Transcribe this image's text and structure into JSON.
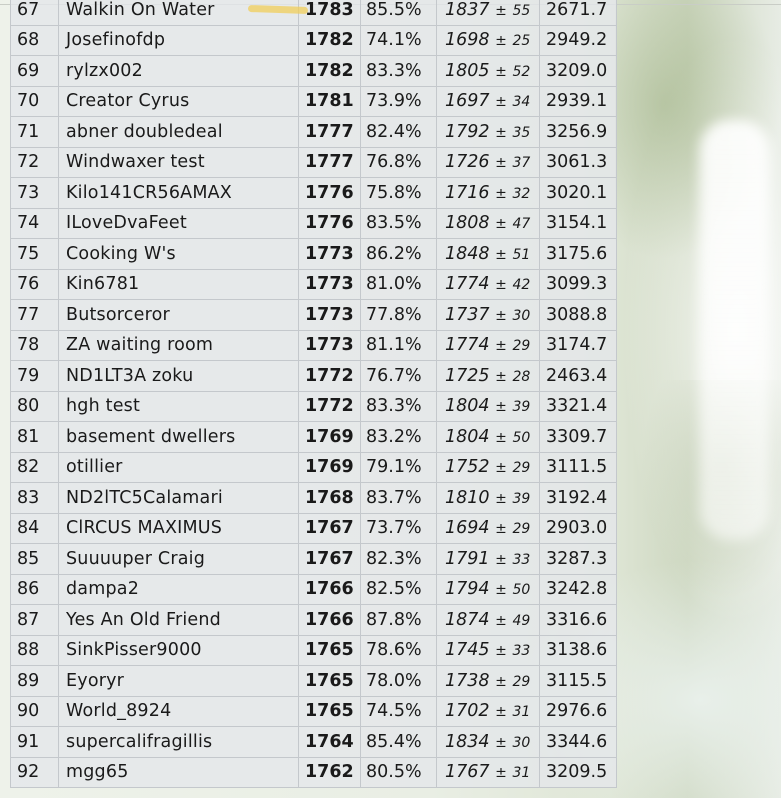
{
  "rows": [
    {
      "rank": "67",
      "name": "Walkin On Water",
      "rating": "1783",
      "win": "85.5%",
      "est": "1837",
      "err": "55",
      "score": "2671.7"
    },
    {
      "rank": "68",
      "name": "Josefinofdp",
      "rating": "1782",
      "win": "74.1%",
      "est": "1698",
      "err": "25",
      "score": "2949.2"
    },
    {
      "rank": "69",
      "name": "rylzx002",
      "rating": "1782",
      "win": "83.3%",
      "est": "1805",
      "err": "52",
      "score": "3209.0"
    },
    {
      "rank": "70",
      "name": "Creator Cyrus",
      "rating": "1781",
      "win": "73.9%",
      "est": "1697",
      "err": "34",
      "score": "2939.1"
    },
    {
      "rank": "71",
      "name": "abner doubledeal",
      "rating": "1777",
      "win": "82.4%",
      "est": "1792",
      "err": "35",
      "score": "3256.9"
    },
    {
      "rank": "72",
      "name": "Windwaxer test",
      "rating": "1777",
      "win": "76.8%",
      "est": "1726",
      "err": "37",
      "score": "3061.3"
    },
    {
      "rank": "73",
      "name": "Kilo141CR56AMAX",
      "rating": "1776",
      "win": "75.8%",
      "est": "1716",
      "err": "32",
      "score": "3020.1"
    },
    {
      "rank": "74",
      "name": "ILoveDvaFeet",
      "rating": "1776",
      "win": "83.5%",
      "est": "1808",
      "err": "47",
      "score": "3154.1"
    },
    {
      "rank": "75",
      "name": "Cooking W's",
      "rating": "1773",
      "win": "86.2%",
      "est": "1848",
      "err": "51",
      "score": "3175.6"
    },
    {
      "rank": "76",
      "name": "Kin6781",
      "rating": "1773",
      "win": "81.0%",
      "est": "1774",
      "err": "42",
      "score": "3099.3"
    },
    {
      "rank": "77",
      "name": "Butsorceror",
      "rating": "1773",
      "win": "77.8%",
      "est": "1737",
      "err": "30",
      "score": "3088.8"
    },
    {
      "rank": "78",
      "name": "ZA waiting room",
      "rating": "1773",
      "win": "81.1%",
      "est": "1774",
      "err": "29",
      "score": "3174.7"
    },
    {
      "rank": "79",
      "name": "ND1LT3A zoku",
      "rating": "1772",
      "win": "76.7%",
      "est": "1725",
      "err": "28",
      "score": "2463.4"
    },
    {
      "rank": "80",
      "name": "hgh test",
      "rating": "1772",
      "win": "83.3%",
      "est": "1804",
      "err": "39",
      "score": "3321.4"
    },
    {
      "rank": "81",
      "name": "basement dwellers",
      "rating": "1769",
      "win": "83.2%",
      "est": "1804",
      "err": "50",
      "score": "3309.7"
    },
    {
      "rank": "82",
      "name": "otillier",
      "rating": "1769",
      "win": "79.1%",
      "est": "1752",
      "err": "29",
      "score": "3111.5"
    },
    {
      "rank": "83",
      "name": "ND2lTC5Calamari",
      "rating": "1768",
      "win": "83.7%",
      "est": "1810",
      "err": "39",
      "score": "3192.4"
    },
    {
      "rank": "84",
      "name": "ClRCUS MAXIMUS",
      "rating": "1767",
      "win": "73.7%",
      "est": "1694",
      "err": "29",
      "score": "2903.0"
    },
    {
      "rank": "85",
      "name": "Suuuuper Craig",
      "rating": "1767",
      "win": "82.3%",
      "est": "1791",
      "err": "33",
      "score": "3287.3"
    },
    {
      "rank": "86",
      "name": "dampa2",
      "rating": "1766",
      "win": "82.5%",
      "est": "1794",
      "err": "50",
      "score": "3242.8"
    },
    {
      "rank": "87",
      "name": "Yes An Old Friend",
      "rating": "1766",
      "win": "87.8%",
      "est": "1874",
      "err": "49",
      "score": "3316.6"
    },
    {
      "rank": "88",
      "name": "SinkPisser9000",
      "rating": "1765",
      "win": "78.6%",
      "est": "1745",
      "err": "33",
      "score": "3138.6"
    },
    {
      "rank": "89",
      "name": "Eyoryr",
      "rating": "1765",
      "win": "78.0%",
      "est": "1738",
      "err": "29",
      "score": "3115.5"
    },
    {
      "rank": "90",
      "name": "World_8924",
      "rating": "1765",
      "win": "74.5%",
      "est": "1702",
      "err": "31",
      "score": "2976.6"
    },
    {
      "rank": "91",
      "name": "supercalifragillis",
      "rating": "1764",
      "win": "85.4%",
      "est": "1834",
      "err": "30",
      "score": "3344.6"
    },
    {
      "rank": "92",
      "name": "mgg65",
      "rating": "1762",
      "win": "80.5%",
      "est": "1767",
      "err": "31",
      "score": "3209.5"
    }
  ],
  "plus_minus": "±",
  "colors": {
    "table_bg": "#e4e7ea",
    "grid": "#c4c8cc",
    "highlight": "#f0cd5a"
  }
}
